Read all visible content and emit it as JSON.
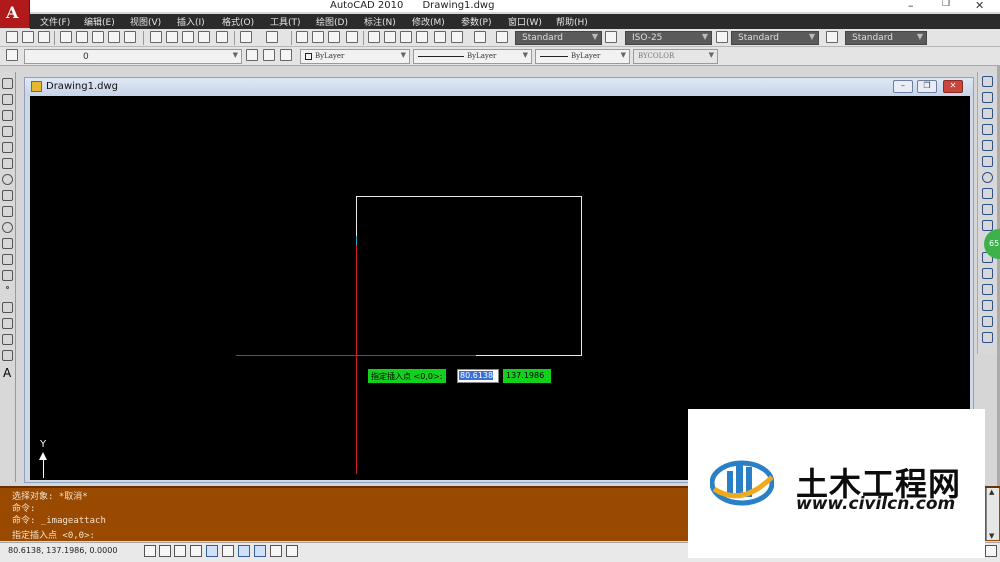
{
  "window": {
    "app_name": "AutoCAD 2010",
    "file_name": "Drawing1.dwg",
    "controls": [
      "–",
      "❐",
      "✕"
    ]
  },
  "menubar": {
    "items": [
      "文件(F)",
      "编辑(E)",
      "视图(V)",
      "插入(I)",
      "格式(O)",
      "工具(T)",
      "绘图(D)",
      "标注(N)",
      "修改(M)",
      "参数(P)",
      "窗口(W)",
      "帮助(H)"
    ]
  },
  "toolbar": {
    "text_style": "Standard",
    "dim_style": "ISO-25",
    "table_style": "Standard",
    "multileader_style": "Standard",
    "layer": "0",
    "color": "ByLayer",
    "linetype": "ByLayer",
    "lineweight": "ByLayer",
    "plot_style": "BYCOLOR"
  },
  "document": {
    "title": "Drawing1.dwg",
    "btn_minimize": "–",
    "btn_restore": "❐",
    "btn_close": "✕"
  },
  "dynamic_input": {
    "prompt": "指定插入点 <0,0>:",
    "x_value": "80.6138",
    "y_value": "137.1986"
  },
  "ucs": {
    "y_label": "Y"
  },
  "command_line": {
    "history": [
      "选择对象: *取消*",
      "命令:",
      "命令: _imageattach"
    ],
    "current": "指定插入点 <0,0>:"
  },
  "status_bar": {
    "coords": "80.6138, 137.1986, 0.0000"
  },
  "watermark": {
    "name_cn": "土木工程网",
    "url": "www.civilcn.com"
  },
  "badge": {
    "text": "65"
  },
  "colors": {
    "canvas": "#000000",
    "command_bg": "#9a4a00",
    "prompt_green": "#12d11d",
    "crosshair": "#d42020",
    "menubar": "#2b2b2b"
  }
}
